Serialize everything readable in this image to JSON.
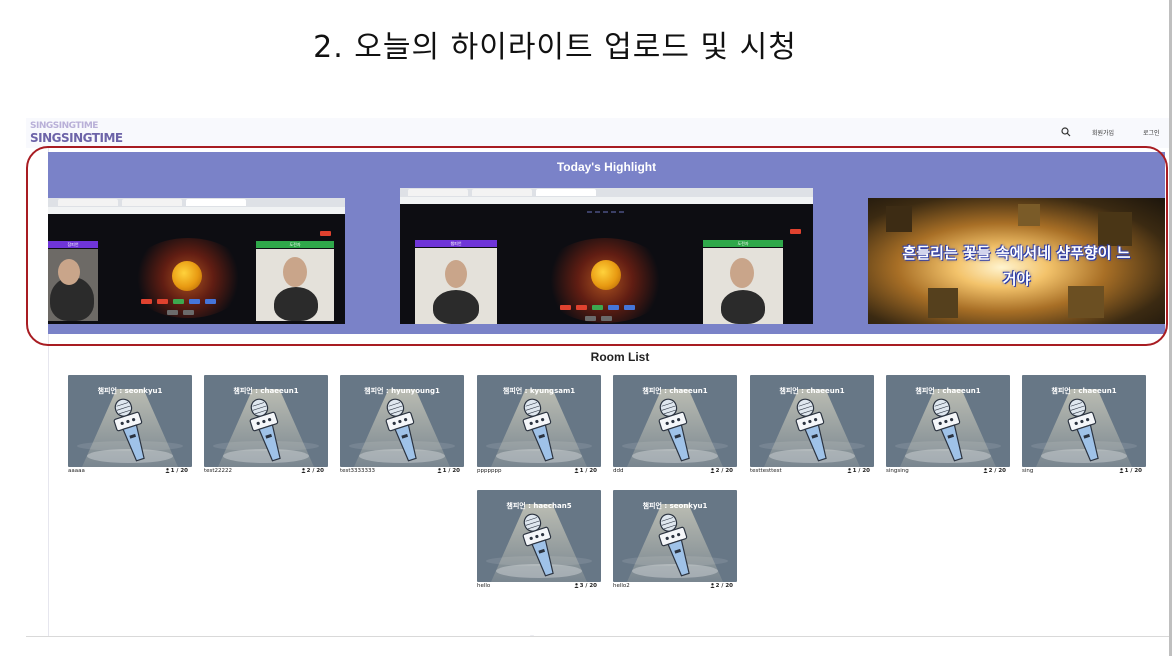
{
  "slide": {
    "title": "2. 오늘의 하이라이트 업로드 및 시청"
  },
  "navbar": {
    "logo_line1": "SINGSINGTIME",
    "logo_line2": "SINGSINGTIME",
    "search_icon": "search-icon",
    "signup_label": "회원가입",
    "login_label": "로그인"
  },
  "highlight": {
    "title": "Today's Highlight",
    "slide1": {
      "player_left": "참피언",
      "center_label": "하트",
      "center_red": "챔피언",
      "center_suffix": "에게 도전하세요!",
      "player_right": "도전자"
    },
    "slide2": {
      "player_left": "챔피언",
      "center_label": "지금",
      "center_red": "챔피언",
      "center_suffix": "에게 도전하세요!",
      "player_right": "도전자"
    },
    "lyric_line1": "흔들리는 꽃들 속에서네 샴푸향이 느",
    "lyric_line2": "거야",
    "indicator_count": 5,
    "outline_color": "#a81c22"
  },
  "rooms": {
    "title": "Room List",
    "items": [
      {
        "champion": "챔피언 : seonkyu1",
        "name": "aaaaa",
        "count": "1 / 20"
      },
      {
        "champion": "챔피언 : chaeeun1",
        "name": "test22222",
        "count": "2 / 20"
      },
      {
        "champion": "챔피언 : hyunyoung1",
        "name": "test3333333",
        "count": "1 / 20"
      },
      {
        "champion": "챔피언 : kyungsam1",
        "name": "ppppppp",
        "count": "1 / 20"
      },
      {
        "champion": "챔피언 : chaeeun1",
        "name": "ddd",
        "count": "2 / 20"
      },
      {
        "champion": "챔피언 : chaeeun1",
        "name": "testtesttest",
        "count": "1 / 20"
      },
      {
        "champion": "챔피언 : chaeeun1",
        "name": "singsing",
        "count": "2 / 20"
      },
      {
        "champion": "챔피언 : chaeeun1",
        "name": "sing",
        "count": "1 / 20"
      },
      {
        "champion": "챔피언 : haechan5",
        "name": "hello",
        "count": "3 / 20"
      },
      {
        "champion": "챔피언 : seonkyu1",
        "name": "hello2",
        "count": "2 / 20"
      }
    ]
  },
  "colors": {
    "highlight_band": "#7a82c8",
    "card_background": "#677786",
    "outline": "#a81c22"
  }
}
